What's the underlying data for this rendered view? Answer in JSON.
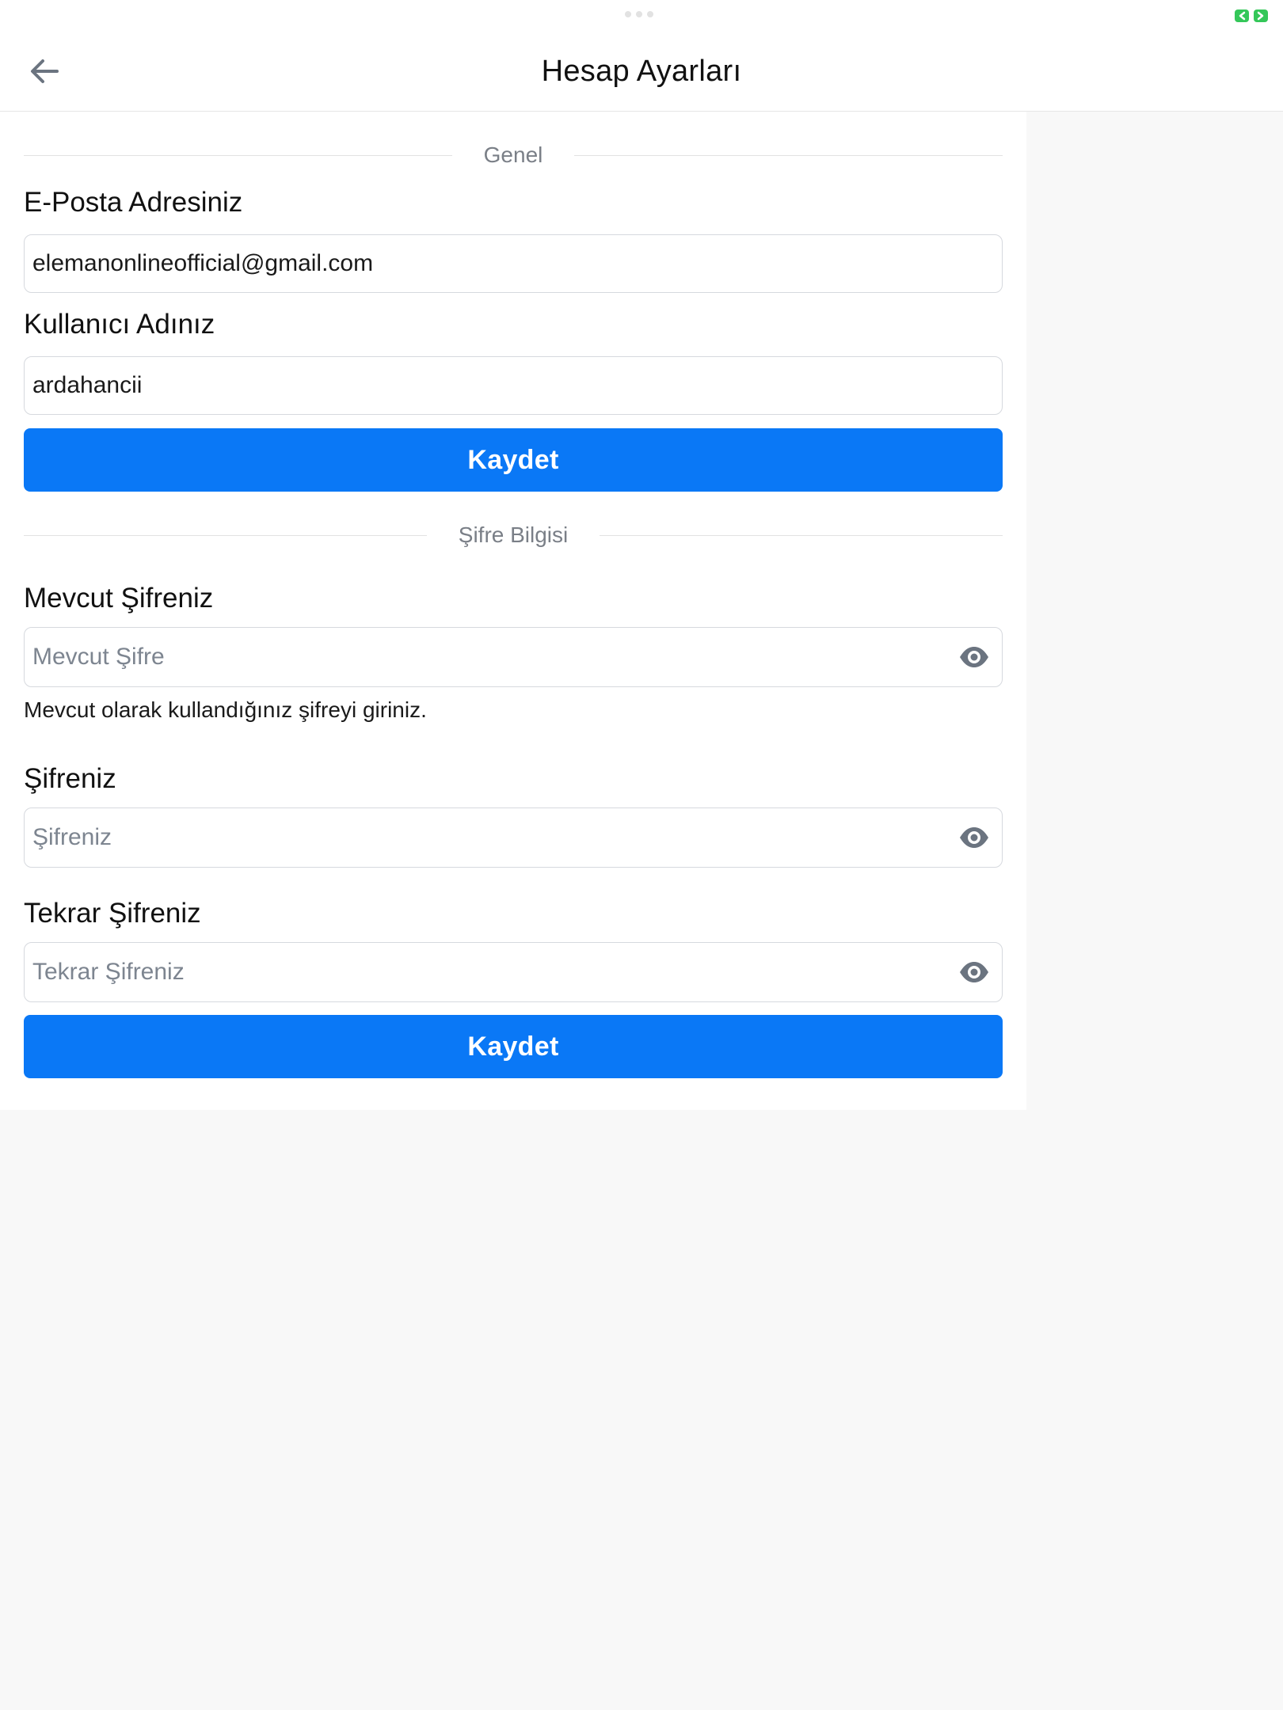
{
  "colors": {
    "accent": "#0a78f6",
    "status_indicator": "#34c759",
    "background": "#f8f8f8",
    "panel": "#ffffff",
    "eye_icon": "#6b7480"
  },
  "header": {
    "title": "Hesap Ayarları",
    "back_icon": "arrow-left-icon"
  },
  "general_section": {
    "divider_label": "Genel",
    "email": {
      "label": "E-Posta Adresiniz",
      "value": "elemanonlineofficial@gmail.com"
    },
    "username": {
      "label": "Kullanıcı Adınız",
      "value": "ardahancii"
    },
    "save_label": "Kaydet"
  },
  "password_section": {
    "divider_label": "Şifre Bilgisi",
    "current_password": {
      "label": "Mevcut Şifreniz",
      "placeholder": "Mevcut Şifre",
      "hint": "Mevcut olarak kullandığınız şifreyi giriniz."
    },
    "new_password": {
      "label": "Şifreniz",
      "placeholder": "Şifreniz"
    },
    "repeat_password": {
      "label": "Tekrar Şifreniz",
      "placeholder": "Tekrar Şifreniz"
    },
    "visibility_icon": "eye-icon",
    "save_label": "Kaydet"
  }
}
